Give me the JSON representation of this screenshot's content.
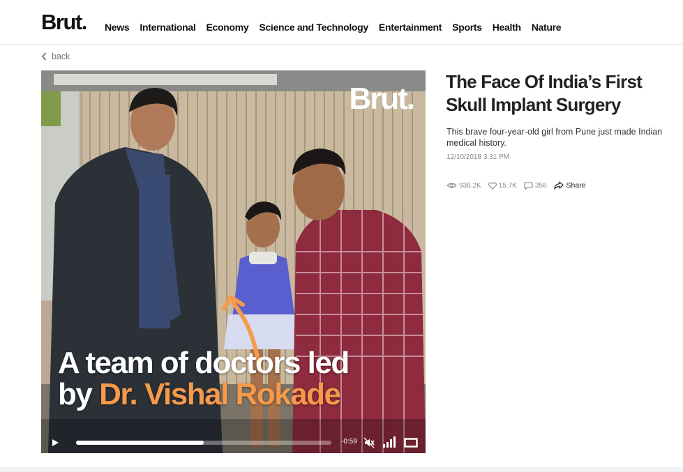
{
  "header": {
    "logo": "Brut.",
    "nav": [
      "News",
      "International",
      "Economy",
      "Science and Technology",
      "Entertainment",
      "Sports",
      "Health",
      "Nature"
    ]
  },
  "back_label": "back",
  "video": {
    "watermark": "Brut.",
    "caption_line1": "A team of doctors led",
    "caption_by": "by ",
    "caption_name": "Dr. Vishal Rokade",
    "time_remaining": "-0:59",
    "progress_fraction": 0.5,
    "caption_name_color": "#f59a4b"
  },
  "article": {
    "title": "The Face Of India’s First Skull Implant Surgery",
    "description": "This brave four-year-old girl from Pune just made Indian medical history.",
    "date": "12/10/2018 3:31 PM",
    "views": "936.2K",
    "likes": "15.7K",
    "comments": "356",
    "share_label": "Share"
  },
  "icons": {
    "back": "chevron-left-icon",
    "play": "play-icon",
    "mute": "mute-icon",
    "volume": "volume-bars-icon",
    "fullscreen": "fullscreen-icon",
    "views": "eye-icon",
    "likes": "heart-icon",
    "comments": "comment-icon",
    "share": "share-icon"
  }
}
